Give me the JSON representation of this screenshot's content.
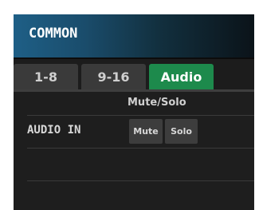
{
  "header": {
    "title": "COMMON"
  },
  "tabs": [
    {
      "label": "1-8",
      "active": false
    },
    {
      "label": "9-16",
      "active": false
    },
    {
      "label": "Audio",
      "active": true
    }
  ],
  "table": {
    "column_header": "Mute/Solo",
    "rows": [
      {
        "label": "AUDIO IN",
        "mute_label": "Mute",
        "solo_label": "Solo"
      }
    ]
  },
  "colors": {
    "active_tab": "#1d8a4c",
    "header_blue": "#1e5f86",
    "panel_bg": "#1c1c1c"
  }
}
